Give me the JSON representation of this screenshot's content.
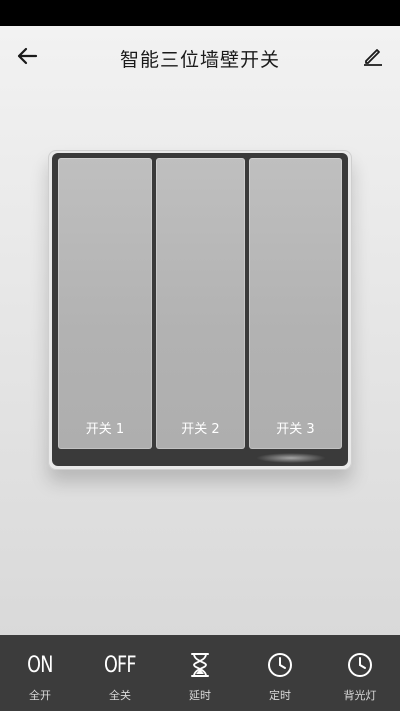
{
  "header": {
    "title": "智能三位墙壁开关"
  },
  "switches": [
    {
      "label": "开关 1"
    },
    {
      "label": "开关 2"
    },
    {
      "label": "开关 3"
    }
  ],
  "toolbar": {
    "all_on": {
      "icon_text": "ON",
      "label": "全开"
    },
    "all_off": {
      "icon_text": "OFF",
      "label": "全关"
    },
    "delay": {
      "label": "延时"
    },
    "timer": {
      "label": "定时"
    },
    "backlight": {
      "label": "背光灯"
    }
  }
}
